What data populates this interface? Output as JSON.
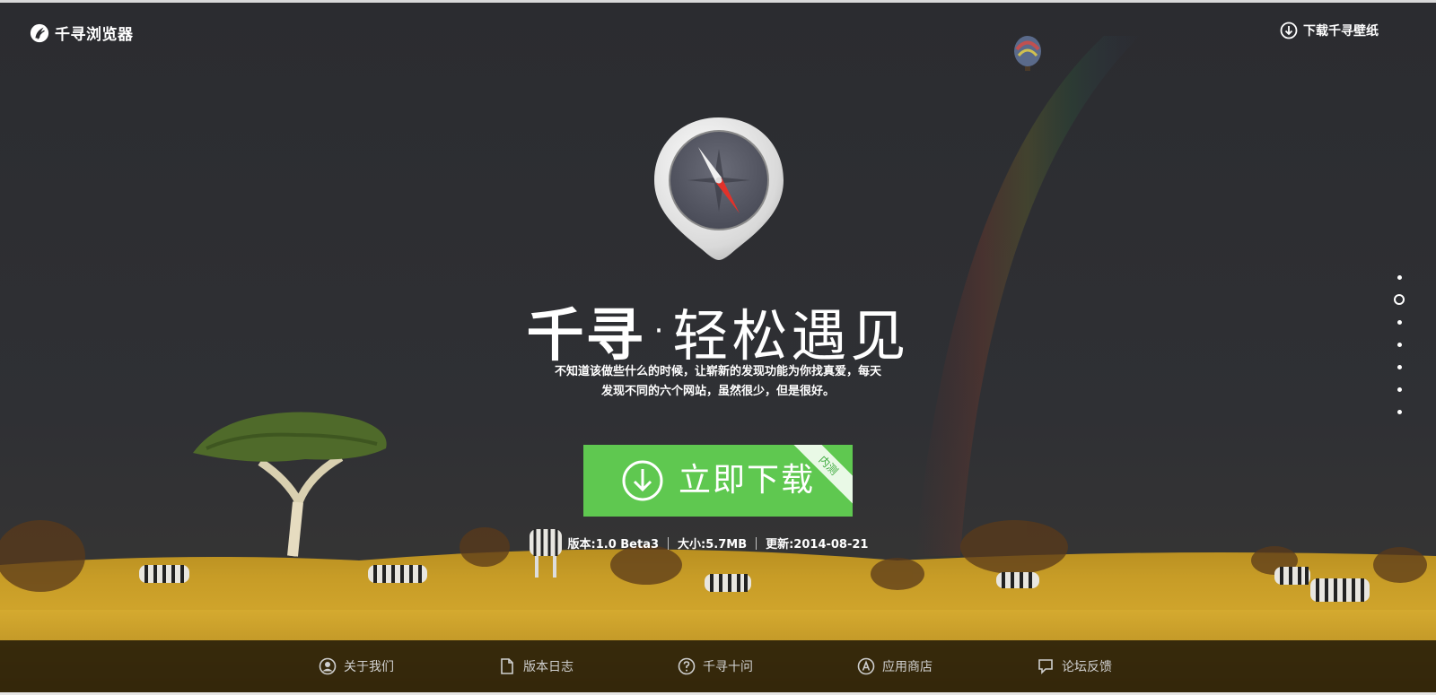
{
  "app": {
    "name": "千寻浏览器"
  },
  "header": {
    "wallpaper_link": "下载千寻壁纸"
  },
  "hero": {
    "brand": "千寻",
    "separator": "·",
    "slogan": "轻松遇见",
    "description_line1": "不知道该做些什么的时候，让崭新的发现功能为你找真爱，每天",
    "description_line2": "发现不同的六个网站，虽然很少，但是很好。"
  },
  "download": {
    "label": "立即下载",
    "ribbon": "内测",
    "button_color": "#5fc850"
  },
  "meta": {
    "version": "版本:1.0 Beta3",
    "size": "大小:5.7MB",
    "updated": "更新:2014-08-21"
  },
  "pager": {
    "count": 7,
    "active_index": 1
  },
  "footer": {
    "items": [
      {
        "label": "关于我们",
        "icon": "user-icon"
      },
      {
        "label": "版本日志",
        "icon": "document-icon"
      },
      {
        "label": "千寻十问",
        "icon": "question-icon"
      },
      {
        "label": "应用商店",
        "icon": "app-store-icon"
      },
      {
        "label": "论坛反馈",
        "icon": "comment-icon"
      }
    ]
  },
  "colors": {
    "sky": "#2a2b2e",
    "grass": "#c9a22a",
    "footer": "#231a08",
    "accent": "#5fc850"
  }
}
